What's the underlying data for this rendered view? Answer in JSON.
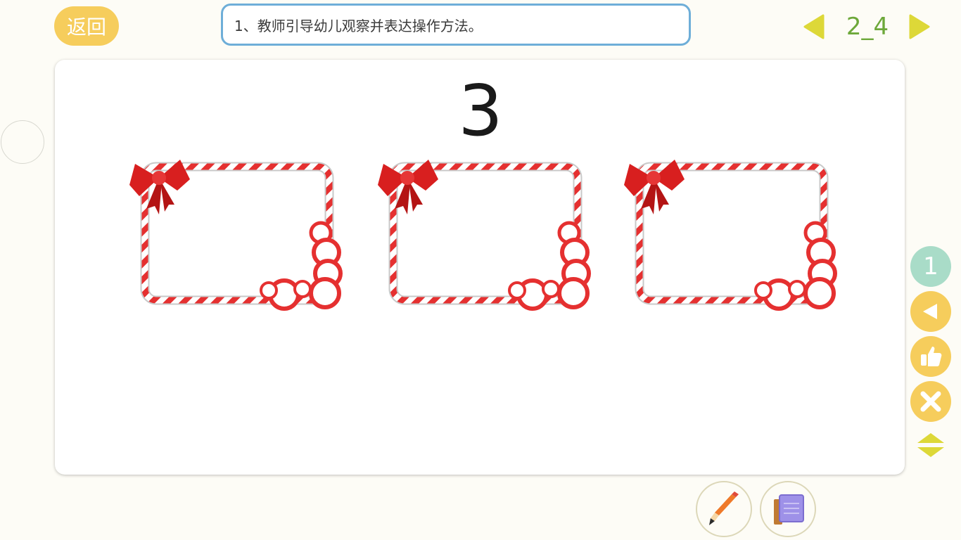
{
  "header": {
    "back_label": "返回",
    "instruction": "1、教师引导幼儿观察并表达操作方法。",
    "page_number": "2_4"
  },
  "main": {
    "number": "3",
    "frames": [
      "candy-frame-1",
      "candy-frame-2",
      "candy-frame-3"
    ]
  },
  "rail": {
    "count": "1"
  },
  "colors": {
    "accent_yellow": "#f6cd5c",
    "page_green": "#6da83a",
    "instruction_border": "#6eaed8",
    "count_mint": "#a9dcc8",
    "candy_red": "#e53030"
  },
  "icons": {
    "prev": "triangle-left-icon",
    "next": "triangle-right-icon",
    "back": "triangle-left-icon",
    "like": "thumbs-up-icon",
    "close": "close-icon",
    "toggle": "expand-collapse-icon",
    "pencil": "pencil-icon",
    "book": "book-icon"
  }
}
